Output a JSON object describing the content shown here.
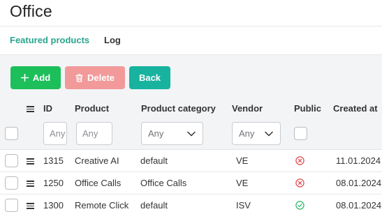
{
  "page": {
    "title": "Office"
  },
  "tabs": [
    {
      "label": "Featured products",
      "active": true
    },
    {
      "label": "Log",
      "active": false
    }
  ],
  "toolbar": {
    "add_label": "Add",
    "delete_label": "Delete",
    "back_label": "Back"
  },
  "table": {
    "headers": {
      "id": "ID",
      "product": "Product",
      "category": "Product category",
      "vendor": "Vendor",
      "public": "Public",
      "created_at": "Created at"
    },
    "filters": {
      "id_placeholder": "Any",
      "product_placeholder": "Any",
      "category_value": "Any",
      "vendor_value": "Any"
    },
    "rows": [
      {
        "id": "1315",
        "product": "Creative AI",
        "category": "default",
        "vendor": "VE",
        "public": "no",
        "created_at": "11.01.2024"
      },
      {
        "id": "1250",
        "product": "Office Calls",
        "category": "Office Calls",
        "vendor": "VE",
        "public": "no",
        "created_at": "08.01.2024"
      },
      {
        "id": "1300",
        "product": "Remote Click",
        "category": "default",
        "vendor": "ISV",
        "public": "yes",
        "created_at": "08.01.2024"
      }
    ]
  },
  "colors": {
    "accent": "#2aa58f",
    "add": "#1cbf5a",
    "delete": "#f29a9a",
    "back": "#17b39f",
    "public_no": "#e0474c",
    "public_yes": "#2fb36a"
  }
}
